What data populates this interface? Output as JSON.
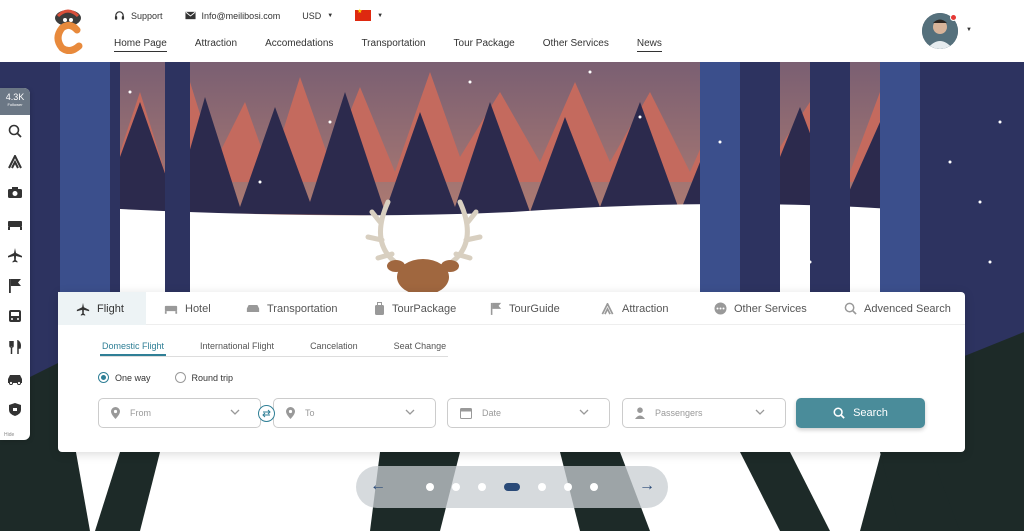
{
  "header": {
    "support_label": "Support",
    "email": "Info@meilibosi.com",
    "currency": "USD",
    "nav": [
      {
        "label": "Home Page",
        "active": true
      },
      {
        "label": "Attraction",
        "active": false
      },
      {
        "label": "Accomedations",
        "active": false
      },
      {
        "label": "Transportation",
        "active": false
      },
      {
        "label": "Tour Package",
        "active": false
      },
      {
        "label": "Other Services",
        "active": false
      },
      {
        "label": "News",
        "active": true
      }
    ]
  },
  "sidebar": {
    "followers_count": "4.3K",
    "followers_label": "Follower",
    "hide_label": "Hide",
    "icons": [
      "search-icon",
      "attraction-icon",
      "camera-icon",
      "bed-icon",
      "plane-icon",
      "flag-icon",
      "bus-icon",
      "restaurant-icon",
      "car-icon",
      "shield-icon"
    ]
  },
  "search": {
    "tabs": [
      {
        "label": "Flight",
        "icon": "plane-icon",
        "active": true
      },
      {
        "label": "Hotel",
        "icon": "bed-icon"
      },
      {
        "label": "Transportation",
        "icon": "car-icon"
      },
      {
        "label": "TourPackage",
        "icon": "luggage-icon"
      },
      {
        "label": "TourGuide",
        "icon": "flag-icon"
      },
      {
        "label": "Attraction",
        "icon": "attraction-icon"
      },
      {
        "label": "Other Services",
        "icon": "more-icon"
      },
      {
        "label": "Advenced Search",
        "icon": "advanced-search-icon"
      }
    ],
    "subtabs": [
      "Domestic Flight",
      "International Flight",
      "Cancelation",
      "Seat Change"
    ],
    "trip_types": [
      "One way",
      "Round trip"
    ],
    "from_placeholder": "From",
    "to_placeholder": "To",
    "date_placeholder": "Date",
    "passengers_placeholder": "Passengers",
    "search_button": "Search"
  },
  "carousel": {
    "slide_count": 7,
    "active_index": 3
  },
  "colors": {
    "accent": "#2f7f96",
    "button": "#4a8c9a",
    "carousel_active": "#2a4a78",
    "sky_top": "#9b6b72",
    "sky_bottom": "#e2a676",
    "trees_dark": "#2b2b4e",
    "trunks": "#3b4f8c"
  }
}
